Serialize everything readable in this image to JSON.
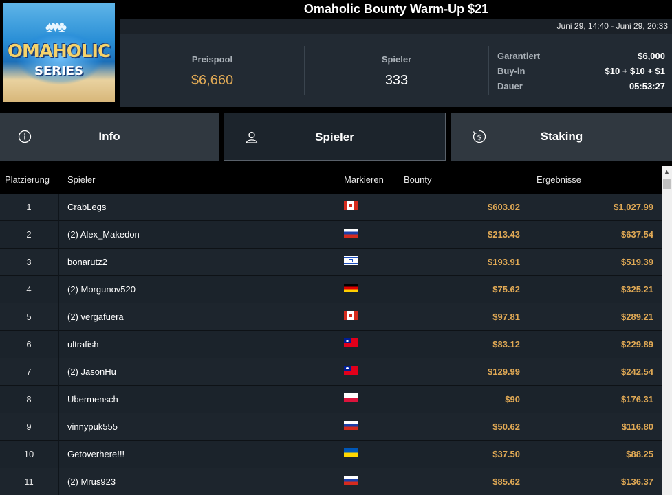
{
  "header": {
    "logo_line1": "OMAHOLIC",
    "logo_line2": "SERIES",
    "title": "Omaholic Bounty Warm-Up $21",
    "dates": "Juni 29, 14:40 - Juni 29, 20:33"
  },
  "stats": {
    "prize_pool_label": "Preispool",
    "prize_pool_value": "$6,660",
    "players_label": "Spieler",
    "players_value": "333",
    "details": [
      {
        "key": "Garantiert",
        "value": "$6,000"
      },
      {
        "key": "Buy-in",
        "value": "$10 + $10 + $1"
      },
      {
        "key": "Dauer",
        "value": "05:53:27"
      }
    ]
  },
  "tabs": [
    {
      "label": "Info",
      "icon": "info-icon",
      "active": false
    },
    {
      "label": "Spieler",
      "icon": "user-icon",
      "active": true
    },
    {
      "label": "Staking",
      "icon": "dollar-cycle-icon",
      "active": false
    }
  ],
  "table": {
    "headers": {
      "rank": "Platzierung",
      "player": "Spieler",
      "flag": "Markieren",
      "bounty": "Bounty",
      "results": "Ergebnisse"
    },
    "rows": [
      {
        "rank": "1",
        "player": "CrabLegs",
        "flag": "canada",
        "bounty": "$603.02",
        "result": "$1,027.99"
      },
      {
        "rank": "2",
        "player": "(2) Alex_Makedon",
        "flag": "russia",
        "bounty": "$213.43",
        "result": "$637.54"
      },
      {
        "rank": "3",
        "player": "bonarutz2",
        "flag": "israel",
        "bounty": "$193.91",
        "result": "$519.39"
      },
      {
        "rank": "4",
        "player": "(2) Morgunov520",
        "flag": "germany",
        "bounty": "$75.62",
        "result": "$325.21"
      },
      {
        "rank": "5",
        "player": "(2) vergafuera",
        "flag": "canada",
        "bounty": "$97.81",
        "result": "$289.21"
      },
      {
        "rank": "6",
        "player": "ultrafish",
        "flag": "taiwan",
        "bounty": "$83.12",
        "result": "$229.89"
      },
      {
        "rank": "7",
        "player": "(2) JasonHu",
        "flag": "taiwan",
        "bounty": "$129.99",
        "result": "$242.54"
      },
      {
        "rank": "8",
        "player": "Ubermensch",
        "flag": "poland",
        "bounty": "$90",
        "result": "$176.31"
      },
      {
        "rank": "9",
        "player": "vinnypuk555",
        "flag": "russia",
        "bounty": "$50.62",
        "result": "$116.80"
      },
      {
        "rank": "10",
        "player": "Getoverhere!!!",
        "flag": "ukraine",
        "bounty": "$37.50",
        "result": "$88.25"
      },
      {
        "rank": "11",
        "player": "(2) Mrus923",
        "flag": "russia",
        "bounty": "$85.62",
        "result": "$136.37"
      }
    ]
  },
  "colors": {
    "accent_gold": "#e0a955",
    "panel": "#222a33",
    "row": "#1d252d"
  }
}
